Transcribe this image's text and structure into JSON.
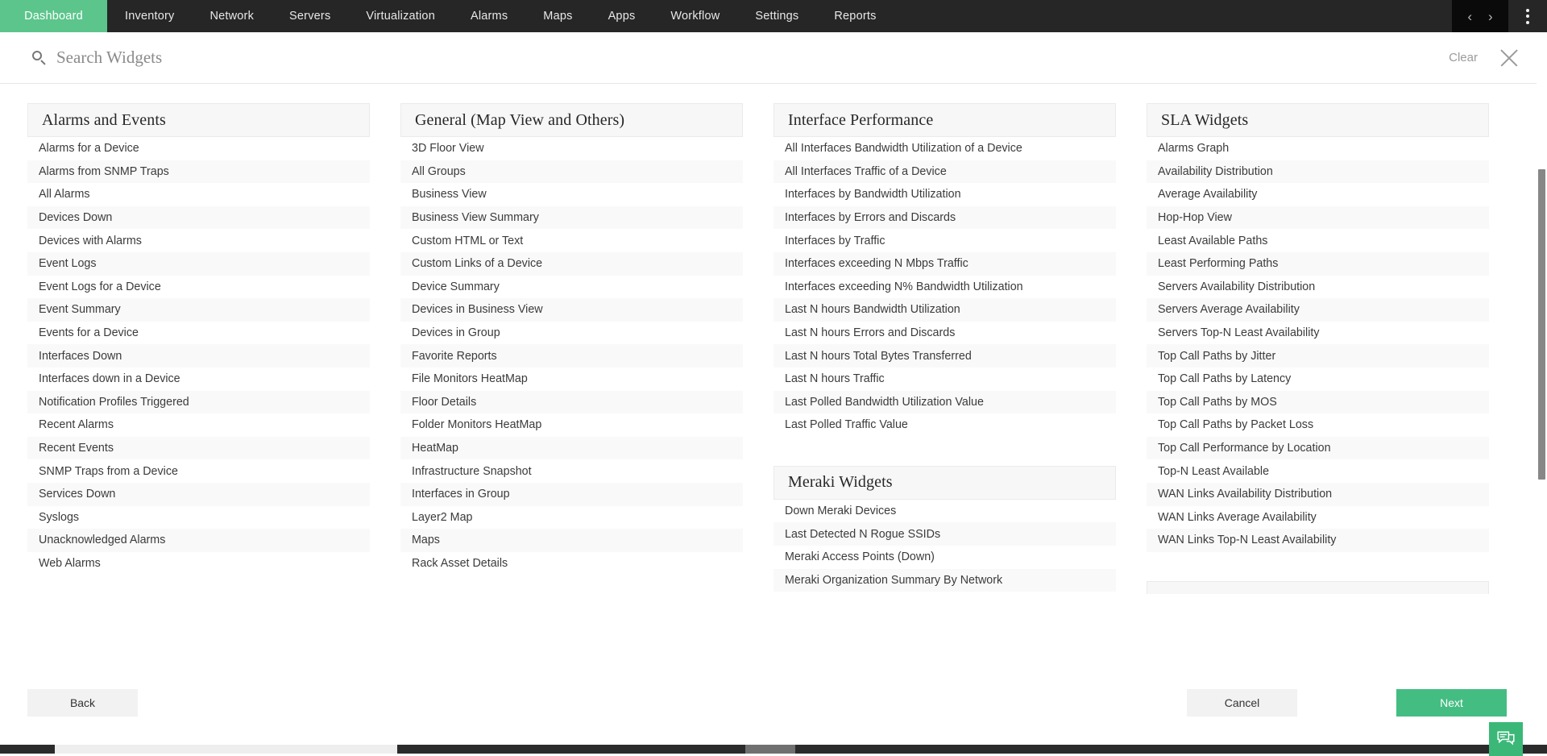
{
  "nav": {
    "items": [
      {
        "label": "Dashboard",
        "active": true
      },
      {
        "label": "Inventory",
        "active": false
      },
      {
        "label": "Network",
        "active": false
      },
      {
        "label": "Servers",
        "active": false
      },
      {
        "label": "Virtualization",
        "active": false
      },
      {
        "label": "Alarms",
        "active": false
      },
      {
        "label": "Maps",
        "active": false
      },
      {
        "label": "Apps",
        "active": false
      },
      {
        "label": "Workflow",
        "active": false
      },
      {
        "label": "Settings",
        "active": false
      },
      {
        "label": "Reports",
        "active": false
      }
    ],
    "prev_icon": "chevron-left-icon",
    "next_icon": "chevron-right-icon",
    "kebab_icon": "more-vertical-icon",
    "prev_glyph": "‹",
    "next_glyph": "›",
    "active_color": "#5CC58C",
    "background_color": "#262626"
  },
  "search": {
    "placeholder": "Search Widgets",
    "value": "",
    "icon": "search-icon",
    "clear_label": "Clear",
    "close_icon": "close-icon"
  },
  "columns": [
    {
      "sections": [
        {
          "title": "Alarms and Events",
          "items": [
            "Alarms for a Device",
            "Alarms from SNMP Traps",
            "All Alarms",
            "Devices Down",
            "Devices with Alarms",
            "Event Logs",
            "Event Logs for a Device",
            "Event Summary",
            "Events for a Device",
            "Interfaces Down",
            "Interfaces down in a Device",
            "Notification Profiles Triggered",
            "Recent Alarms",
            "Recent Events",
            "SNMP Traps from a Device",
            "Services Down",
            "Syslogs",
            "Unacknowledged Alarms",
            "Web Alarms"
          ]
        }
      ]
    },
    {
      "sections": [
        {
          "title": "General (Map View and Others)",
          "items": [
            "3D Floor View",
            "All Groups",
            "Business View",
            "Business View Summary",
            "Custom HTML or Text",
            "Custom Links of a Device",
            "Device Summary",
            "Devices in Business View",
            "Devices in Group",
            "Favorite Reports",
            "File Monitors HeatMap",
            "Floor Details",
            "Folder Monitors HeatMap",
            "HeatMap",
            "Infrastructure Snapshot",
            "Interfaces in Group",
            "Layer2 Map",
            "Maps",
            "Rack Asset Details"
          ]
        }
      ]
    },
    {
      "sections": [
        {
          "title": "Interface Performance",
          "items": [
            "All Interfaces Bandwidth Utilization of a Device",
            "All Interfaces Traffic of a Device",
            "Interfaces by Bandwidth Utilization",
            "Interfaces by Errors and Discards",
            "Interfaces by Traffic",
            "Interfaces exceeding N Mbps Traffic",
            "Interfaces exceeding N% Bandwidth Utilization",
            "Last N hours Bandwidth Utilization",
            "Last N hours Errors and Discards",
            "Last N hours Total Bytes Transferred",
            "Last N hours Traffic",
            "Last Polled Bandwidth Utilization Value",
            "Last Polled Traffic Value"
          ]
        },
        {
          "title": "Meraki Widgets",
          "items": [
            "Down Meraki Devices",
            "Last Detected N Rogue SSIDs",
            "Meraki Access Points (Down)",
            "Meraki Organization Summary By Network"
          ]
        }
      ]
    },
    {
      "sections": [
        {
          "title": "SLA Widgets",
          "items": [
            "Alarms Graph",
            "Availability Distribution",
            "Average Availability",
            "Hop-Hop View",
            "Least Available Paths",
            "Least Performing Paths",
            "Servers Availability Distribution",
            "Servers Average Availability",
            "Servers Top-N Least Availability",
            "Top Call Paths by Jitter",
            "Top Call Paths by Latency",
            "Top Call Paths by MOS",
            "Top Call Paths by Packet Loss",
            "Top Call Performance by Location",
            "Top-N Least Available",
            "WAN Links Availability Distribution",
            "WAN Links Average Availability",
            "WAN Links Top-N Least Availability"
          ]
        },
        {
          "title": "",
          "items": []
        }
      ]
    }
  ],
  "footer": {
    "back_label": "Back",
    "cancel_label": "Cancel",
    "next_label": "Next",
    "next_color": "#44BD83"
  },
  "chat": {
    "icon": "chat-bubbles-icon",
    "color": "#3BB878"
  }
}
